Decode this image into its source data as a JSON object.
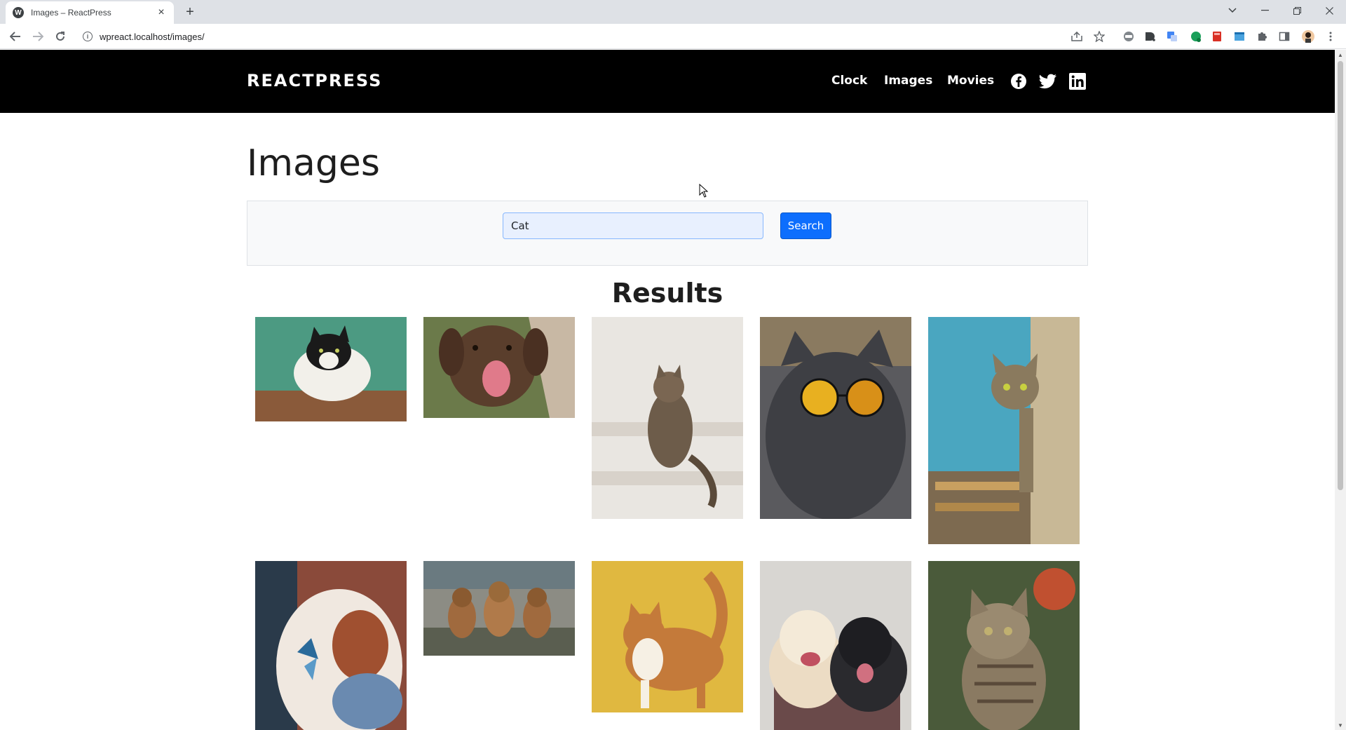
{
  "browser": {
    "tab_title": "Images – ReactPress",
    "tab_favicon": "W",
    "tab_close": "×",
    "new_tab": "+",
    "url": "wpreact.localhost/images/",
    "info_icon": "i"
  },
  "site": {
    "brand": "REACTPRESS",
    "nav": [
      "Clock",
      "Images",
      "Movies"
    ]
  },
  "page": {
    "title": "Images",
    "search_value": "Cat",
    "search_button": "Search",
    "results_title": "Results"
  },
  "results": [
    {
      "name": "cat-on-box",
      "palette": [
        "#4c9a82",
        "#8a5a3a",
        "#f2f0ea"
      ]
    },
    {
      "name": "dog-licking",
      "palette": [
        "#6b7a4a",
        "#5a3e2c",
        "#c8b8a4"
      ]
    },
    {
      "name": "cat-on-stairs",
      "palette": [
        "#e9e6e1",
        "#6d5c4a",
        "#d8d2ca"
      ]
    },
    {
      "name": "cat-sunglasses",
      "palette": [
        "#5a5a5e",
        "#3e3f44",
        "#e8b020"
      ]
    },
    {
      "name": "cat-peeking",
      "palette": [
        "#4aa6c0",
        "#7d6a50",
        "#c8b896"
      ]
    },
    {
      "name": "cat-butterfly",
      "palette": [
        "#8a4a3a",
        "#f0e8e0",
        "#2a6a9a"
      ]
    },
    {
      "name": "three-puppies",
      "palette": [
        "#8c8c84",
        "#a06a3e",
        "#5a5e50"
      ]
    },
    {
      "name": "ginger-cat",
      "palette": [
        "#e0b840",
        "#c47a3a",
        "#f6f0e4"
      ]
    },
    {
      "name": "two-dogs",
      "palette": [
        "#d8d6d2",
        "#2a2a2e",
        "#ecdcc4"
      ]
    },
    {
      "name": "tabby-kitten",
      "palette": [
        "#4a5a3a",
        "#8a7a62",
        "#c0b094"
      ]
    }
  ]
}
